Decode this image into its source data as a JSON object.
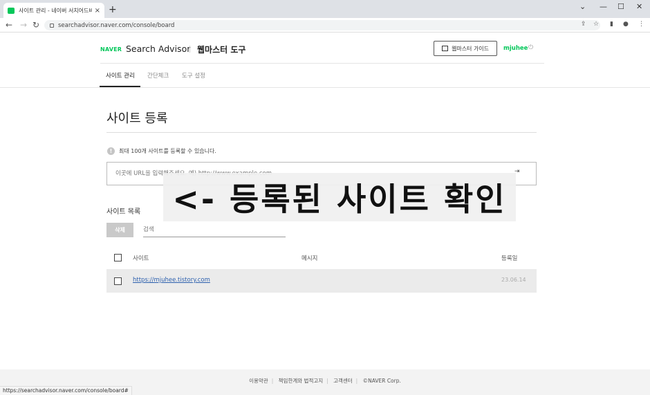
{
  "browser": {
    "tab_title": "사이트 관리 - 네이버 서치어드바",
    "tab_close": "×",
    "new_tab": "+",
    "url": "searchadvisor.naver.com/console/board",
    "status_url": "https://searchadvisor.naver.com/console/board#",
    "controls": {
      "collapse": "⌄",
      "minimize": "—",
      "maximize": "☐",
      "close": "✕"
    }
  },
  "header": {
    "naver": "NAVER",
    "product": "Search Advisor",
    "tool": "웹마스터 도구",
    "guide_button": "웹마스터 가이드",
    "user": "mjuhee"
  },
  "menu": {
    "items": [
      "사이트 관리",
      "간단체크",
      "도구 설정"
    ],
    "active": "사이트 관리"
  },
  "main": {
    "title": "사이트 등록",
    "info": "최대 100개 사이트를 등록할 수 있습니다.",
    "url_placeholder": "이곳에 URL을 입력해주세요. 예) http://www.example.com",
    "overlay": "<- 등록된 사이트 확인",
    "list_title": "사이트 목록",
    "delete_button": "삭제",
    "search_placeholder": "검색",
    "columns": [
      "사이트",
      "메시지",
      "등록일"
    ],
    "rows": [
      {
        "site": "https://mjuhee.tistory.com",
        "message": "",
        "date": "23.06.14"
      }
    ]
  },
  "footer": {
    "links": [
      "이용약관",
      "책임한계와 법적고지",
      "고객센터",
      "©NAVER Corp."
    ]
  },
  "colors": {
    "naver_green": "#03c75a",
    "link_blue": "#2b5fad"
  }
}
